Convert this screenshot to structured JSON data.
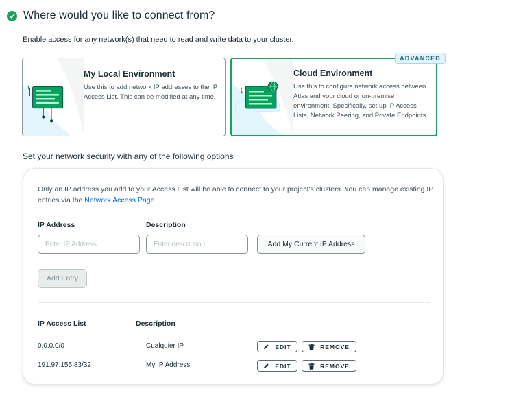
{
  "header": {
    "title": "Where would you like to connect from?"
  },
  "intro": "Enable access for any network(s) that need to read and write data to your cluster.",
  "cards": {
    "local": {
      "title": "My Local Environment",
      "desc": "Use this to add network IP addresses to the IP Access List. This can be modified at any time."
    },
    "cloud": {
      "badge": "ADVANCED",
      "title": "Cloud Environment",
      "desc": "Use this to configure network access between Atlas and your cloud or on-premise environment. Specifically, set up IP Access Lists, Network Peering, and Private Endpoints."
    }
  },
  "section_title": "Set your network security with any of the following options",
  "panel": {
    "notice_text": "Only an IP address you add to your Access List will be able to connect to your project's clusters. You can manage existing IP entries via the ",
    "notice_link": "Network Access Page",
    "notice_end": ".",
    "ip_label": "IP Address",
    "desc_label": "Description",
    "ip_placeholder": "Enter IP Address",
    "desc_placeholder": "Enter description",
    "add_current_ip": "Add My Current IP Address",
    "add_entry": "Add Entry",
    "list_header_ip": "IP Access List",
    "list_header_desc": "Description",
    "rows": [
      {
        "ip": "0.0.0.0/0",
        "desc": "Cualquier IP",
        "edit": "EDIT",
        "remove": "REMOVE"
      },
      {
        "ip": "191.97.155.83/32",
        "desc": "My IP Address",
        "edit": "EDIT",
        "remove": "REMOVE"
      }
    ]
  },
  "colors": {
    "accent": "#1aa160",
    "link": "#016bf8",
    "badge_bg": "#e3f4fc"
  }
}
